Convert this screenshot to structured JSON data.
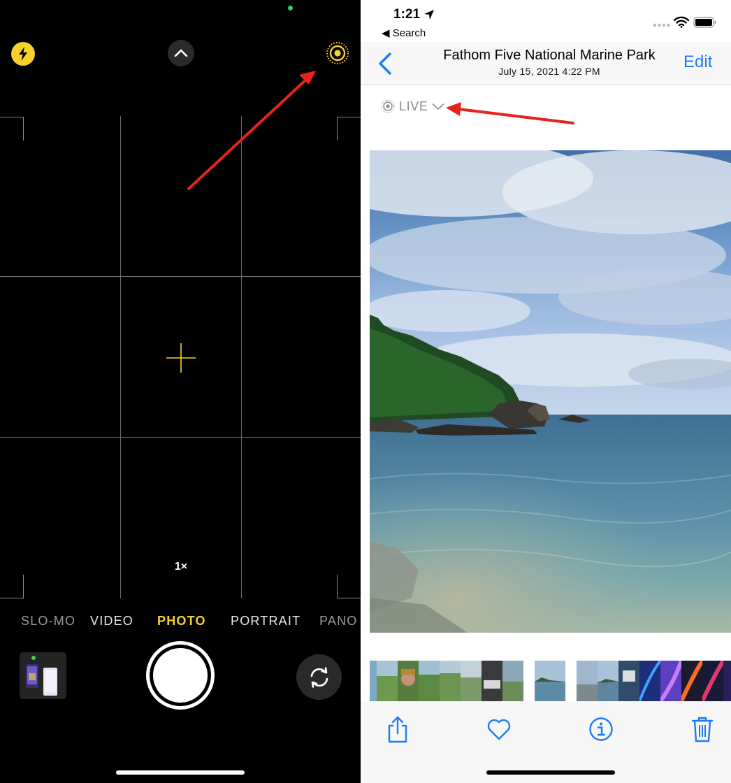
{
  "camera": {
    "zoom_label": "1×",
    "modes": [
      {
        "label": "SLO-MO",
        "state": "faded"
      },
      {
        "label": "VIDEO",
        "state": "normal"
      },
      {
        "label": "PHOTO",
        "state": "active"
      },
      {
        "label": "PORTRAIT",
        "state": "normal"
      },
      {
        "label": "PANO",
        "state": "faded"
      }
    ],
    "colors": {
      "accent": "#f6d22d",
      "background": "#000000"
    },
    "icons": [
      "flash-icon",
      "chevron-up-icon",
      "live-photo-icon",
      "focus-crosshair-icon",
      "camera-flip-icon"
    ]
  },
  "photos": {
    "status": {
      "time": "1:21",
      "back_label": "Search"
    },
    "nav": {
      "title": "Fathom Five National Marine Park",
      "subtitle": "July 15, 2021  4:22 PM",
      "edit_label": "Edit"
    },
    "live_label": "LIVE",
    "colors": {
      "tint": "#1a7cf5",
      "live_gray": "#8a8a8e"
    },
    "icons": [
      "back-chevron-icon",
      "share-icon",
      "heart-icon",
      "info-icon",
      "trash-icon"
    ]
  },
  "annotations": {
    "arrow_color": "#e8231c"
  }
}
